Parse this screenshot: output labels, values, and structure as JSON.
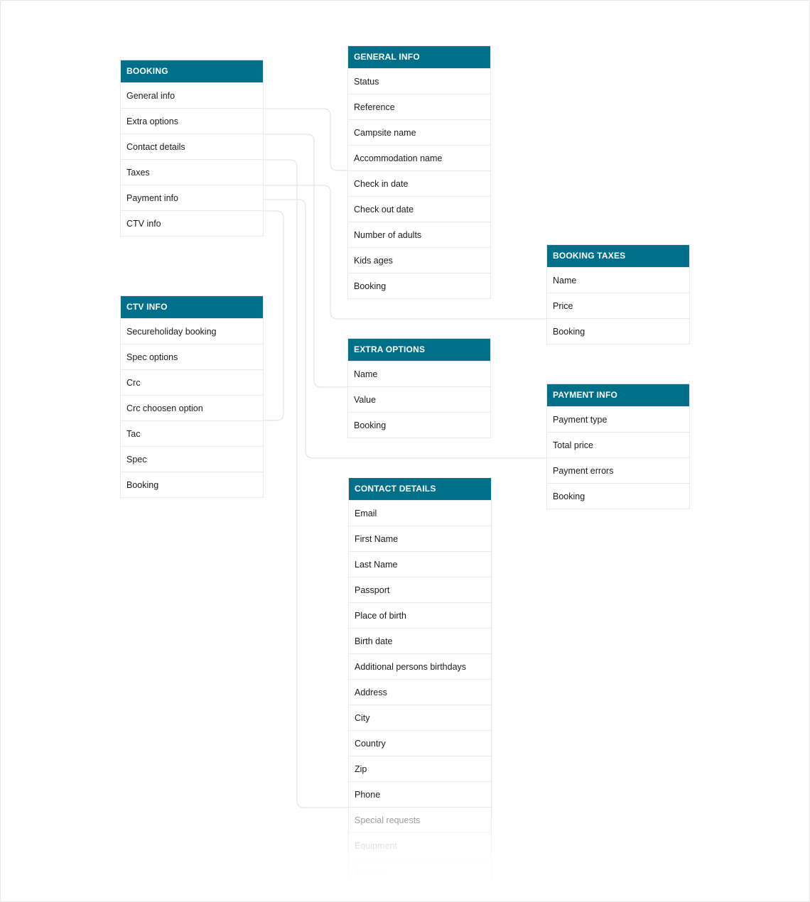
{
  "diagram": {
    "accent_color": "#00708a",
    "tables": {
      "booking": {
        "title": "BOOKING",
        "fields": [
          "General info",
          "Extra options",
          "Contact details",
          "Taxes",
          "Payment info",
          "CTV info"
        ]
      },
      "general_info": {
        "title": "GENERAL INFO",
        "fields": [
          "Status",
          "Reference",
          "Campsite name",
          "Accommodation name",
          "Check in date",
          "Check out date",
          "Number of adults",
          "Kids ages",
          "Booking"
        ]
      },
      "ctv_info": {
        "title": "CTV INFO",
        "fields": [
          "Secureholiday booking",
          "Spec options",
          "Crc",
          "Crc choosen option",
          "Tac",
          "Spec",
          "Booking"
        ]
      },
      "extra_options": {
        "title": "EXTRA OPTIONS",
        "fields": [
          "Name",
          "Value",
          "Booking"
        ]
      },
      "booking_taxes": {
        "title": "BOOKING TAXES",
        "fields": [
          "Name",
          "Price",
          "Booking"
        ]
      },
      "payment_info": {
        "title": "PAYMENT INFO",
        "fields": [
          "Payment type",
          "Total price",
          "Payment errors",
          "Booking"
        ]
      },
      "contact_details": {
        "title": "CONTACT DETAILS",
        "fields": [
          "Email",
          "First Name",
          "Last Name",
          "Passport",
          "Place of birth",
          "Birth date",
          "Additional persons birthdays",
          "Address",
          "City",
          "Country",
          "Zip",
          "Phone",
          "Special requests",
          "Equipment",
          "Booking"
        ]
      }
    },
    "relations": [
      {
        "from": "booking.General info",
        "to": "general_info"
      },
      {
        "from": "booking.Extra options",
        "to": "extra_options"
      },
      {
        "from": "booking.Contact details",
        "to": "contact_details"
      },
      {
        "from": "booking.Taxes",
        "to": "booking_taxes"
      },
      {
        "from": "booking.Payment info",
        "to": "payment_info"
      },
      {
        "from": "booking.CTV info",
        "to": "ctv_info"
      }
    ]
  }
}
